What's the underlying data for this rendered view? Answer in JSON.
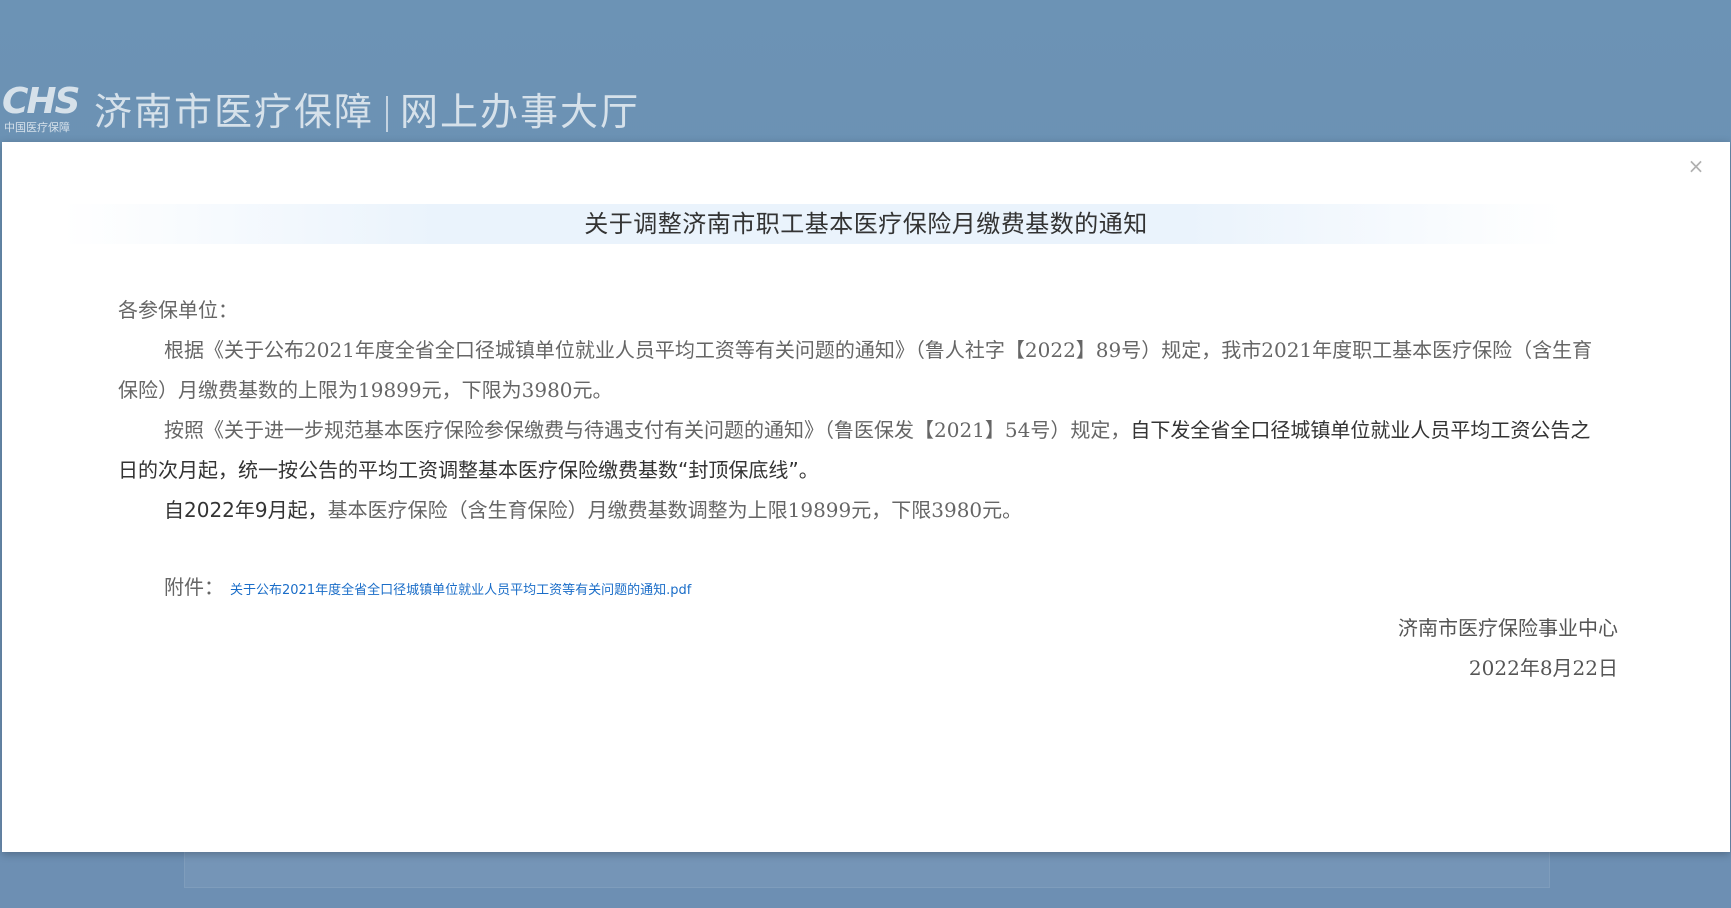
{
  "site": {
    "logo_mark": "CHS",
    "logo_sub": "中国医疗保障",
    "title_left": "济南市医疗保障",
    "title_right": "网上办事大厅"
  },
  "modal": {
    "close_label": "×",
    "title": "关于调整济南市职工基本医疗保险月缴费基数的通知",
    "salutation": "各参保单位：",
    "para1": "根据《关于公布2021年度全省全口径城镇单位就业人员平均工资等有关问题的通知》（鲁人社字【2022】89号）规定，我市2021年度职工基本医疗保险（含生育保险）月缴费基数的上限为19899元，下限为3980元。",
    "para2_normal": "按照《关于进一步规范基本医疗保险参保缴费与待遇支付有关问题的通知》（鲁医保发【2021】54号）规定，",
    "para2_strong": "自下发全省全口径城镇单位就业人员平均工资公告之日的次月起，统一按公告的平均工资调整基本医疗保险缴费基数“封顶保底线”。",
    "para3_strong": "自2022年9月起，",
    "para3_normal": "基本医疗保险（含生育保险）月缴费基数调整为上限19899元，下限3980元。",
    "attachment_label": "附件：",
    "attachment_link": "关于公布2021年度全省全口径城镇单位就业人员平均工资等有关问题的通知.pdf",
    "signature_org": "济南市医疗保险事业中心",
    "signature_date": "2022年8月22日"
  }
}
